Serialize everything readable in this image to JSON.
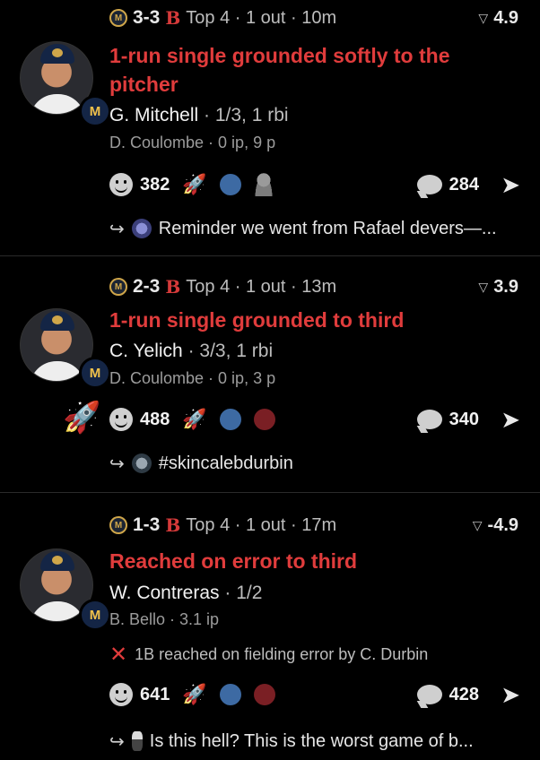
{
  "plays": [
    {
      "header": {
        "score": "3-3",
        "team_mark": "B",
        "inning": "Top 4 · 1 out · 10m",
        "leverage": "4.9"
      },
      "title": "1-run single grounded softly to the pitcher",
      "batter": {
        "name": "G. Mitchell",
        "line": "· 1/3, 1 rbi"
      },
      "pitcher": "D. Coulombe · 0 ip, 9 p",
      "reactions": {
        "count": "382",
        "dot1": "#3d6aa3"
      },
      "comments": "284",
      "reply": "Reminder we went from Rafael devers—..."
    },
    {
      "header": {
        "score": "2-3",
        "team_mark": "B",
        "inning": "Top 4 · 1 out · 13m",
        "leverage": "3.9"
      },
      "title": "1-run single grounded to third",
      "batter": {
        "name": "C. Yelich",
        "line": "· 3/3, 1 rbi"
      },
      "pitcher": "D. Coulombe · 0 ip, 3 p",
      "reactions": {
        "count": "488",
        "dot1": "#3d6aa3",
        "dot2": "#7a1f24"
      },
      "comments": "340",
      "reply": "#skincalebdurbin"
    },
    {
      "header": {
        "score": "1-3",
        "team_mark": "B",
        "inning": "Top 4 · 1 out · 17m",
        "leverage": "-4.9"
      },
      "title": "Reached on error to third",
      "batter": {
        "name": "W. Contreras",
        "line": "· 1/2"
      },
      "pitcher": "B. Bello · 3.1 ip",
      "error": "1B reached on fielding error by C. Durbin",
      "reactions": {
        "count": "641",
        "dot1": "#3d6aa3",
        "dot2": "#7a1f24"
      },
      "comments": "428",
      "reply": "Is this hell? This is the worst game of b..."
    }
  ],
  "icons": {
    "team_badge": "brewers-logo-icon",
    "rocket": "rocket-icon",
    "smile": "smile-icon",
    "comment": "comment-bubble-icon",
    "share": "share-arrow-icon",
    "reply": "reply-arrow-icon"
  },
  "text": {
    "team_badge_glyph": "M",
    "x_glyph": "✕",
    "share_glyph": "➤",
    "reply_glyph": "↪",
    "rocket_glyph": "🚀"
  }
}
